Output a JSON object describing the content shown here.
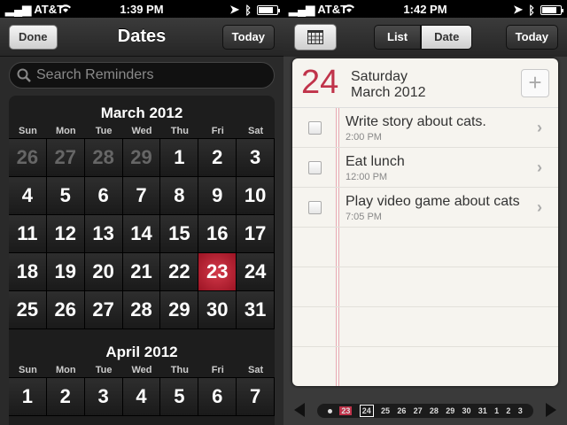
{
  "left_screen": {
    "status": {
      "carrier": "AT&T",
      "time": "1:39 PM"
    },
    "nav": {
      "done_label": "Done",
      "title": "Dates",
      "today_label": "Today"
    },
    "search": {
      "placeholder": "Search Reminders"
    },
    "weekdays": [
      "Sun",
      "Mon",
      "Tue",
      "Wed",
      "Thu",
      "Fri",
      "Sat"
    ],
    "month1": {
      "title": "March 2012",
      "days": [
        "26",
        "27",
        "28",
        "29",
        "1",
        "2",
        "3",
        "4",
        "5",
        "6",
        "7",
        "8",
        "9",
        "10",
        "11",
        "12",
        "13",
        "14",
        "15",
        "16",
        "17",
        "18",
        "19",
        "20",
        "21",
        "22",
        "23",
        "24",
        "25",
        "26",
        "27",
        "28",
        "29",
        "30",
        "31"
      ],
      "dimmed": [
        "26",
        "27",
        "28",
        "29"
      ],
      "selected": "23"
    },
    "month2": {
      "title": "April 2012",
      "days": [
        "1",
        "2",
        "3",
        "4",
        "5",
        "6",
        "7"
      ]
    }
  },
  "right_screen": {
    "status": {
      "carrier": "AT&T",
      "time": "1:42 PM"
    },
    "nav": {
      "list_label": "List",
      "date_label": "Date",
      "today_label": "Today",
      "active_tab": "Date"
    },
    "date_header": {
      "day": "24",
      "weekday": "Saturday",
      "month_year": "March 2012"
    },
    "reminders": [
      {
        "title": "Write story about cats.",
        "time": "2:00 PM"
      },
      {
        "title": "Eat lunch",
        "time": "12:00 PM"
      },
      {
        "title": "Play video game about cats",
        "time": "7:05 PM"
      }
    ],
    "date_strip": [
      "23",
      "24",
      "25",
      "26",
      "27",
      "28",
      "29",
      "30",
      "31",
      "1",
      "2",
      "3"
    ],
    "strip_selected": "23",
    "strip_current": "24"
  },
  "colors": {
    "accent": "#c0334a",
    "dark_bg": "#2a2a2a"
  }
}
